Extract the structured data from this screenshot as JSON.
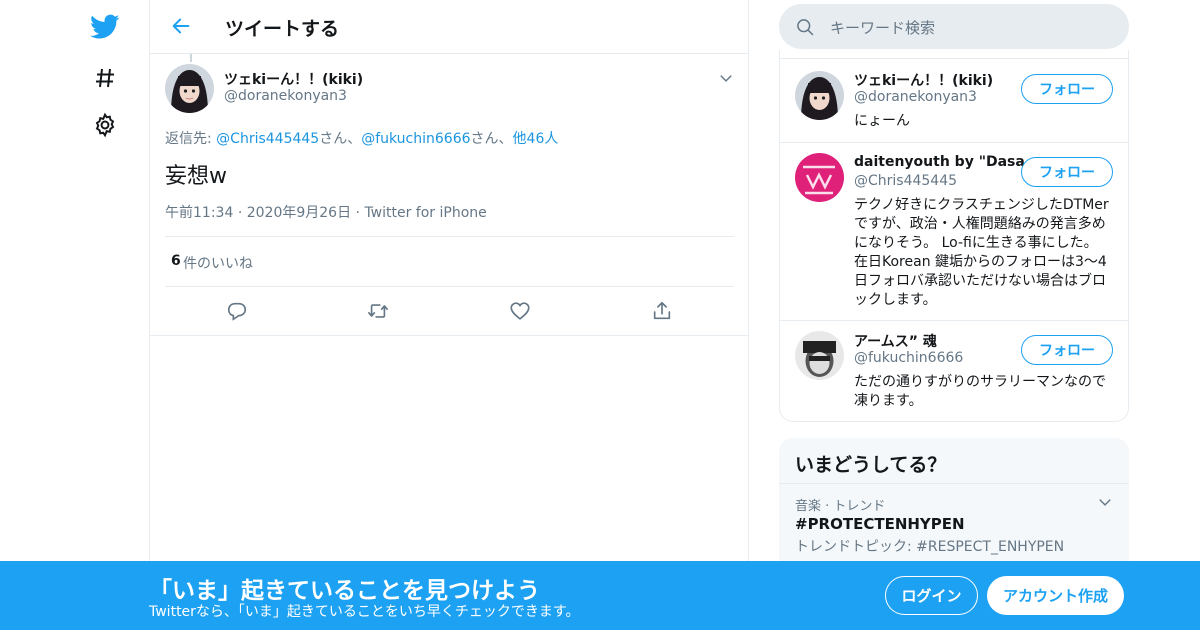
{
  "nav": {
    "icons": [
      "twitter-bird-icon",
      "hashtag-icon",
      "gear-icon"
    ]
  },
  "header": {
    "title": "ツイートする",
    "back_icon": "back-arrow-icon"
  },
  "tweet": {
    "author_name": "ツェkiーん！！(kiki)",
    "author_handle": "@doranekonyan3",
    "reply_prefix": "返信先: ",
    "reply_user_1": "@Chris445445",
    "reply_sep_1": "さん、",
    "reply_user_2": "@fukuchin6666",
    "reply_sep_2": "さん、",
    "reply_others": "他46人",
    "text": "妄想w",
    "time": "午前11:34",
    "date": "2020年9月26日",
    "source": "Twitter for iPhone",
    "likes_count": "6",
    "likes_label": " 件のいいね",
    "actions": [
      "reply-icon",
      "retweet-icon",
      "like-icon",
      "share-icon"
    ]
  },
  "search": {
    "placeholder": "キーワード検索"
  },
  "follow": {
    "button_label": "フォロー",
    "users": [
      {
        "name": "ツェkiーん！！(kiki)",
        "handle": "@doranekonyan3",
        "bio": "にょーん"
      },
      {
        "name": "daitenyouth by \"Dasa...",
        "handle": "@Chris445445",
        "bio": "テクノ好きにクラスチェンジしたDTMerですが、政治・人権問題絡みの発言多めになりそう。 Lo-fiに生きる事にした。 在日Korean 鍵垢からのフォローは3～4日フォロバ承認いただけない場合はブロックします。"
      },
      {
        "name": "アームス” 魂",
        "handle": "@fukuchin6666",
        "bio": "ただの通りすがりのサラリーマンなので凍ります。"
      }
    ]
  },
  "trends": {
    "title": "いまどうしてる？",
    "items": [
      {
        "meta": "音楽 · トレンド",
        "tag": "#PROTECTENHYPEN",
        "sub": "トレンドトピック: #RESPECT_ENHYPEN"
      }
    ]
  },
  "banner": {
    "title": "「いま」起きていることを見つけよう",
    "subtitle": "Twitterなら、「いま」起きていることをいち早くチェックできます。",
    "login": "ログイン",
    "signup": "アカウント作成"
  },
  "colors": {
    "brand": "#1da1f2",
    "link": "#1b95e0",
    "muted": "#657786",
    "border": "#e6ecf0"
  }
}
